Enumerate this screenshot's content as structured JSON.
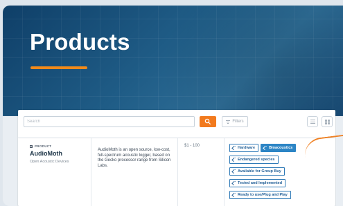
{
  "hero": {
    "title": "Products"
  },
  "search": {
    "placeholder": "Search"
  },
  "filters": {
    "label": "Filters"
  },
  "product": {
    "type_label": "PRODUCT",
    "name": "AudioMoth",
    "vendor": "Open Acoustic Devices",
    "description": "AudioMoth is an open source, low-cost, full-spectrum acoustic logger, based on the Gecko processor range from Silicon Labs.",
    "price": "$1 - 100",
    "tags": [
      "Hardware",
      "Bioacoustics",
      "Endangered species",
      "Available for Group Buy",
      "Tested and Implemented",
      "Ready to use/Plug and Play"
    ]
  },
  "colors": {
    "accent": "#f27a1e",
    "header_blue": "#1f5c86",
    "tag_blue": "#2c85c5"
  }
}
